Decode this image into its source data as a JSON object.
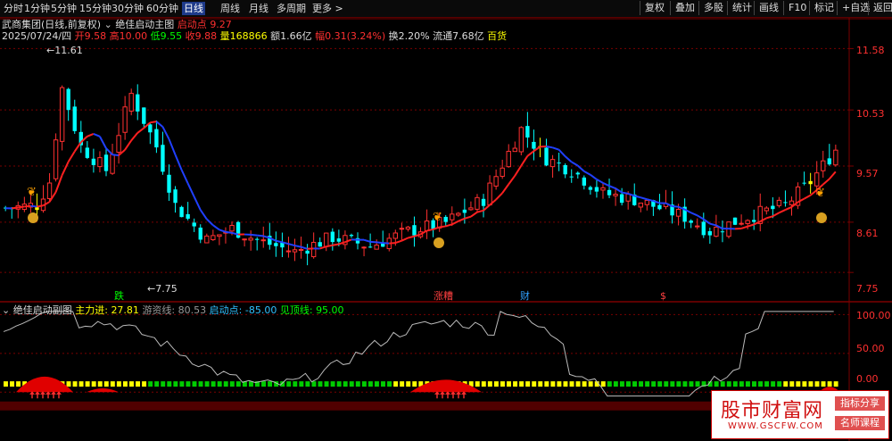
{
  "toolbar": {
    "periods": [
      "分时",
      "1分钟",
      "5分钟",
      "15分钟",
      "30分钟",
      "60分钟",
      "日线",
      "周线",
      "月线",
      "多周期",
      "更多 >"
    ],
    "active_period": "日线",
    "right_buttons": [
      "复权",
      "叠加",
      "多股",
      "统计",
      "画线",
      "F10",
      "标记",
      "+自选",
      "返回"
    ]
  },
  "main_panel": {
    "stock_title": "武商集团(日线,前复权)",
    "indicator_name": "绝佳启动主图",
    "indicator_param_label": "启动点",
    "indicator_param_value": "9.27",
    "date": "2025/07/24/四",
    "open_label": "开",
    "open": "9.58",
    "high_label": "高",
    "high": "10.00",
    "low_label": "低",
    "low": "9.55",
    "close_label": "收",
    "close": "9.88",
    "volume_label": "量",
    "volume": "168866",
    "amount_label": "额",
    "amount": "1.66亿",
    "change_label": "幅",
    "change": "0.31(3.24%)",
    "turnover_label": "换",
    "turnover": "2.20%",
    "float_cap_label": "流通",
    "float_cap": "7.68亿",
    "sector": "百货",
    "high_marker": "11.61",
    "low_marker": "7.75",
    "price_axis": [
      "11.58",
      "10.53",
      "9.57",
      "8.61",
      "7.75"
    ],
    "event_labels": [
      "跌",
      "涨糟",
      "财",
      "$"
    ]
  },
  "sub_panel": {
    "indicator_name": "绝佳启动副图",
    "main_force_label": "主力进:",
    "main_force_value": "27.81",
    "hot_money_label": "游资线:",
    "hot_money_value": "80.53",
    "start_label": "启动点:",
    "start_value": "-85.00",
    "top_label": "见顶线:",
    "top_value": "95.00",
    "axis": [
      "100.00",
      "50.00",
      "0.00"
    ]
  },
  "watermark": {
    "site_name": "股市财富网",
    "url": "WWW.GSCFW.COM",
    "tag1": "指标分享",
    "tag2": "名师课程"
  },
  "colors": {
    "up": "#ff3030",
    "down": "#00ffff",
    "ma_up": "#ff2020",
    "ma_down": "#2040ff",
    "grid": "#7a0000",
    "yellow": "#ffff00",
    "green": "#00cc00"
  },
  "chart_data": {
    "type": "candlestick",
    "price_range": [
      7.6,
      11.8
    ],
    "price_ticks": [
      11.58,
      10.53,
      9.57,
      8.61,
      7.75
    ],
    "sub_range": [
      -10,
      105
    ],
    "sub_ticks": [
      100,
      50,
      0
    ]
  }
}
